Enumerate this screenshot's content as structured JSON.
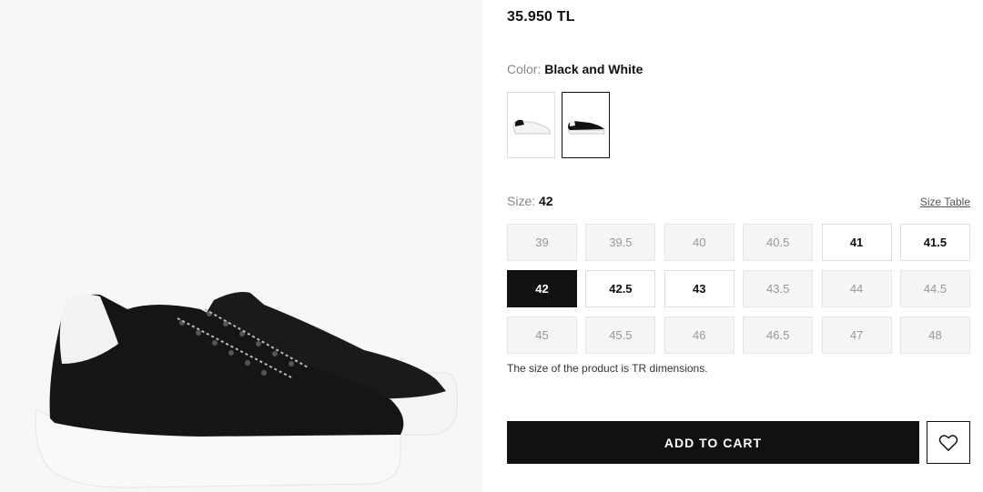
{
  "product": {
    "price": "35.950 TL",
    "image_icon": "sneaker-image"
  },
  "color": {
    "label": "Color:",
    "value": "Black and White",
    "swatches": [
      {
        "name": "white-sneaker",
        "selected": false
      },
      {
        "name": "black-sneaker",
        "selected": true
      }
    ]
  },
  "size": {
    "label": "Size:",
    "value": "42",
    "table_link": "Size Table",
    "options": [
      {
        "label": "39",
        "state": "unavailable"
      },
      {
        "label": "39.5",
        "state": "unavailable"
      },
      {
        "label": "40",
        "state": "unavailable"
      },
      {
        "label": "40.5",
        "state": "unavailable"
      },
      {
        "label": "41",
        "state": "available"
      },
      {
        "label": "41.5",
        "state": "available"
      },
      {
        "label": "42",
        "state": "selected"
      },
      {
        "label": "42.5",
        "state": "available"
      },
      {
        "label": "43",
        "state": "available"
      },
      {
        "label": "43.5",
        "state": "unavailable"
      },
      {
        "label": "44",
        "state": "unavailable"
      },
      {
        "label": "44.5",
        "state": "unavailable"
      },
      {
        "label": "45",
        "state": "unavailable"
      },
      {
        "label": "45.5",
        "state": "unavailable"
      },
      {
        "label": "46",
        "state": "unavailable"
      },
      {
        "label": "46.5",
        "state": "unavailable"
      },
      {
        "label": "47",
        "state": "unavailable"
      },
      {
        "label": "48",
        "state": "unavailable"
      }
    ],
    "note": "The size of the product is TR dimensions."
  },
  "actions": {
    "add_to_cart": "ADD TO CART",
    "wishlist_icon": "heart-icon"
  },
  "colors": {
    "primary": "#111111",
    "unavailable_bg": "#f5f5f5",
    "unavailable_text": "#999999"
  }
}
